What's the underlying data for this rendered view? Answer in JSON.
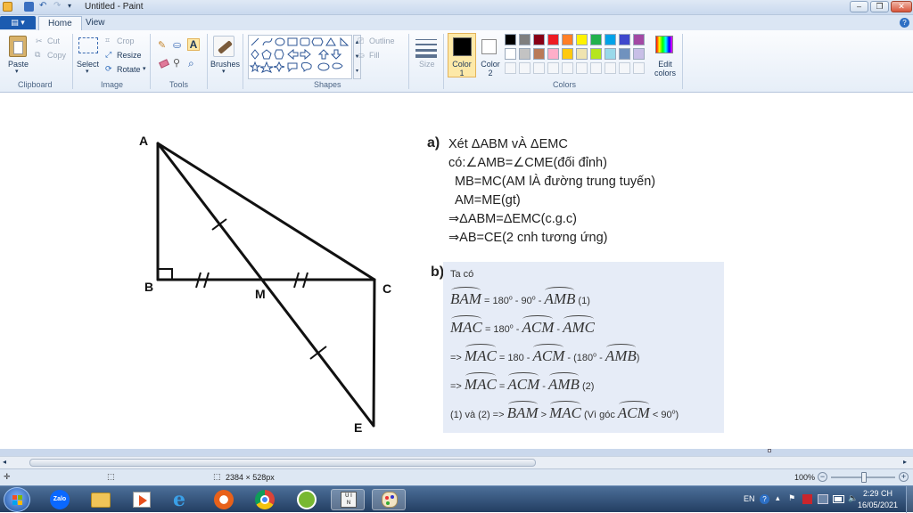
{
  "window": {
    "title": "Untitled - Paint",
    "controls": [
      "minimize",
      "maximize",
      "close"
    ]
  },
  "tabs": {
    "menu_button": "▤ ▾",
    "items": [
      "Home",
      "View"
    ],
    "active": "Home"
  },
  "ribbon": {
    "clipboard": {
      "paste": "Paste",
      "cut": "Cut",
      "copy": "Copy",
      "group": "Clipboard"
    },
    "image": {
      "select": "Select",
      "crop": "Crop",
      "resize": "Resize",
      "rotate": "Rotate",
      "group": "Image"
    },
    "tools": {
      "group": "Tools"
    },
    "brushes": {
      "label": "Brushes"
    },
    "shapes": {
      "outline": "Outline",
      "fill": "Fill",
      "group": "Shapes"
    },
    "size": {
      "label": "Size"
    },
    "colors": {
      "color1": "Color 1",
      "color2": "Color 2",
      "edit": "Edit colors",
      "group": "Colors",
      "color1_value": "#000000",
      "color2_value": "#ffffff",
      "palette_row1": [
        "#000000",
        "#7f7f7f",
        "#880015",
        "#ed1c24",
        "#ff7f27",
        "#fff200",
        "#22b14c",
        "#00a2e8",
        "#3f48cc",
        "#a349a4"
      ],
      "palette_row2": [
        "#ffffff",
        "#c3c3c3",
        "#b97a57",
        "#ffaec9",
        "#ffc90e",
        "#efe4b0",
        "#b5e61d",
        "#99d9ea",
        "#7092be",
        "#c8bfe7"
      ]
    }
  },
  "canvas": {
    "points": {
      "A": "A",
      "B": "B",
      "M": "M",
      "C": "C",
      "E": "E"
    },
    "part_a": {
      "label": "a)",
      "lines": [
        "Xét ΔABM vÀ ΔEMC",
        "có:∠AMB=∠CME(đối đỉnh)",
        "MB=MC(AM lÀ đường trung tuyến)",
        "AM=ME(gt)",
        "⇒ΔABM=ΔEMC(c.g.c)",
        "⇒AB=CE(2 cnh tương ứng)"
      ]
    },
    "part_b": {
      "label": "b)",
      "intro": "Ta có",
      "eq1": {
        "lhs": "BAM",
        "rest": " = 180",
        "rest2": " - 90",
        "rest3": " - ",
        "angle": "AMB",
        "tail": " (1)"
      },
      "eq2": {
        "lhs": "MAC",
        "rest": " = 180",
        "mid": " - ",
        "a1": "ACM",
        "a2": "AMC"
      },
      "eq3": {
        "prefix": "=> ",
        "lhs": "MAC",
        "rest": " = 180 - ",
        "a1": "ACM",
        "paren": " - (180",
        "a2": "AMB",
        "close": ")"
      },
      "eq4": {
        "prefix": "=> ",
        "lhs": "MAC",
        "rest": " = ",
        "a1": "ACM",
        "mid": " - ",
        "a2": "AMB",
        "tail": " (2)"
      },
      "eq5": {
        "prefix": "(1) và (2) => ",
        "a1": "BAM",
        "gt": " > ",
        "a2": "MAC",
        "note": " (Vì góc ",
        "a3": "ACM",
        "tail": " < 90",
        "close": ")"
      },
      "deg": "o"
    }
  },
  "status": {
    "dimensions": "2384 × 528px",
    "zoom": "100%"
  },
  "taskbar": {
    "apps": [
      "start",
      "zalo",
      "file-explorer",
      "media-player",
      "internet-explorer",
      "chrome-alt",
      "chrome",
      "coccoc",
      "unikey",
      "paint"
    ],
    "tray": {
      "lang": "EN",
      "time": "2:29 CH",
      "date": "16/05/2021"
    }
  }
}
